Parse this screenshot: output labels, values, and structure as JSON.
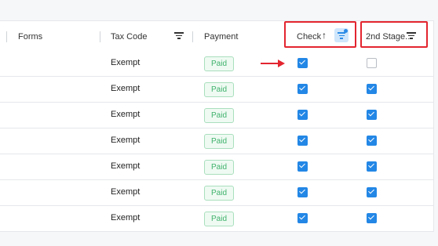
{
  "header": {
    "forms_label": "Forms",
    "taxcode_label": "Tax Code",
    "payment_label": "Payment",
    "check_label": "Check",
    "check_sort_glyph": "↑",
    "stage_label": "2nd Stage..."
  },
  "rows": [
    {
      "tax_code": "Exempt",
      "payment": "Paid",
      "check": true,
      "second_stage": false
    },
    {
      "tax_code": "Exempt",
      "payment": "Paid",
      "check": true,
      "second_stage": true
    },
    {
      "tax_code": "Exempt",
      "payment": "Paid",
      "check": true,
      "second_stage": true
    },
    {
      "tax_code": "Exempt",
      "payment": "Paid",
      "check": true,
      "second_stage": true
    },
    {
      "tax_code": "Exempt",
      "payment": "Paid",
      "check": true,
      "second_stage": true
    },
    {
      "tax_code": "Exempt",
      "payment": "Paid",
      "check": true,
      "second_stage": true
    },
    {
      "tax_code": "Exempt",
      "payment": "Paid",
      "check": true,
      "second_stage": true
    }
  ],
  "icons": {
    "taxcode_filter": "filter-icon",
    "check_filter": "filter-active-icon",
    "stage_filter": "filter-icon",
    "annotation": "red-arrow-icon"
  },
  "colors": {
    "accent": "#2387e6",
    "paid_text": "#3fb26b",
    "annotation": "#e3252f"
  }
}
